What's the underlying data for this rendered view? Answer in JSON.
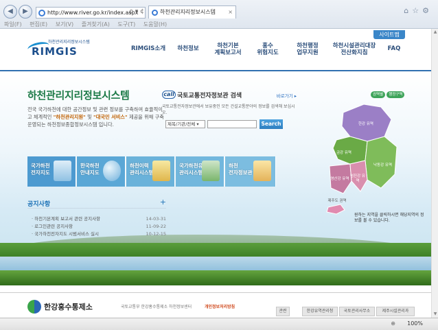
{
  "browser": {
    "address": "http://www.river.go.kr/index.aspx",
    "address_tools": "ρ ▾ ¢",
    "tab_title": "하천관리지리정보시스템",
    "menu": [
      "파일(F)",
      "편집(E)",
      "보기(V)",
      "즐겨찾기(A)",
      "도구(T)",
      "도움말(H)"
    ],
    "zoom": "100%"
  },
  "header": {
    "sitemap": "사이트맵",
    "logo_sub": "하천관리지리정보시스템",
    "logo": "RIMGIS",
    "nav": [
      {
        "line1": "RIMGIS소개",
        "line2": ""
      },
      {
        "line1": "하천정보",
        "line2": ""
      },
      {
        "line1": "하천기본",
        "line2": "계획보고서"
      },
      {
        "line1": "홍수",
        "line2": "위험지도"
      },
      {
        "line1": "하천행정",
        "line2": "업무지원"
      },
      {
        "line1": "하천시설관리대장",
        "line2": "전산화지침"
      },
      {
        "line1": "FAQ",
        "line2": ""
      }
    ]
  },
  "hero": {
    "title": "하천관리지리정보시스템",
    "desc_a": "전국 국가하천에 대한 공간정보 및 관련 정보를 구축하여 효율적이고 체계적인 ",
    "desc_hl1": "\"하천관리지원\"",
    "desc_b": " 및 ",
    "desc_hl2": "\"대국민 서비스\"",
    "desc_c": " 제공을 위해 구축 운영되는 하천정보종합정보시스템 입니다."
  },
  "search": {
    "badge": "call",
    "title": "국토교통전자정보관 검색",
    "more": "바로가기 ▸",
    "desc": "국토교통전자정보관에서 보유중인 모든 건설교통분야의 정보를 검색해 보십시오.",
    "select": "제목/기관/전체 ▾",
    "input": "",
    "button": "Search"
  },
  "quick": [
    {
      "l1": "국가하천",
      "l2": "전자지도",
      "color": "#4d9ad0"
    },
    {
      "l1": "한국하천",
      "l2": "안내지도",
      "color": "#5aa7d6"
    },
    {
      "l1": "하천이력",
      "l2": "관리시스템",
      "color": "#6ab2da"
    },
    {
      "l1": "국가하천유지",
      "l2": "관리시스템",
      "color": "#72b7dd"
    },
    {
      "l1": "하천",
      "l2": "전자정보관",
      "color": "#7cbde0"
    }
  ],
  "notice": {
    "title": "공지사항",
    "plus": "+",
    "rows": [
      {
        "text": "· 하천기본계획 보고서 관련 공지사항",
        "date": "14-03-31"
      },
      {
        "text": "· 로그인관련 공지사항",
        "date": "11-09-22"
      },
      {
        "text": "· 국가하천전자지도 시범서비스 실시",
        "date": "10-12-15"
      }
    ]
  },
  "map": {
    "buttons": [
      "권역별",
      "행정구역"
    ],
    "regions": [
      "금강 유역",
      "영산강 유역",
      "섬진강 유역",
      "낙동강 유역",
      "한강 유역",
      "제주도 권역"
    ],
    "note": "원하는 지역을 클릭하시면 해당지역의 정보를 볼 수 있습니다."
  },
  "footer": {
    "title": "한강홍수통제소",
    "info": "국토교통부 한강홍수통제소 하천정보센터",
    "privacy": "개인정보처리방침",
    "buttons": [
      "관련",
      "한강유역관리청",
      "국토관리사무소",
      "제주시설관리과"
    ]
  }
}
